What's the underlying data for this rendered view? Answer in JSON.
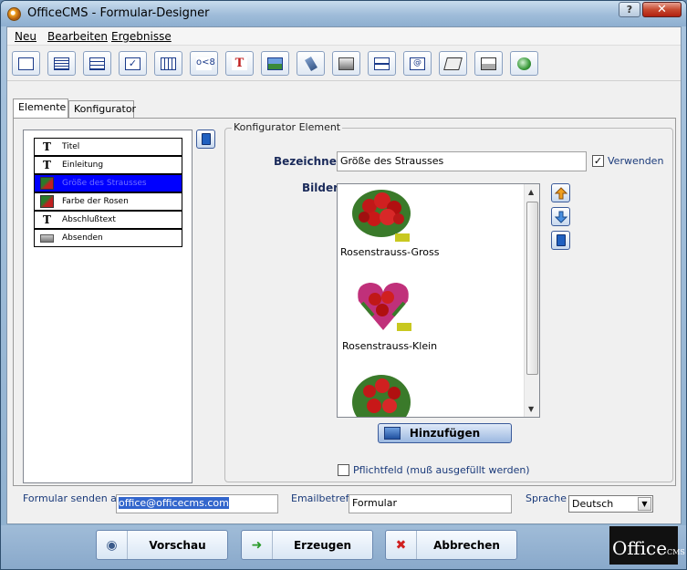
{
  "window": {
    "title": "OfficeCMS - Formular-Designer",
    "help": "?",
    "close": "✕"
  },
  "menu": [
    {
      "label": "Neu"
    },
    {
      "label": "Bearbeiten"
    },
    {
      "label": "Ergebnisse"
    }
  ],
  "toolbar": {
    "icons": [
      "single-field-icon",
      "text-block-icon",
      "list-icon",
      "checkbox-icon",
      "table-icon",
      "branch-icon",
      "title-text-icon",
      "image-icon",
      "attachment-icon",
      "button-icon",
      "separator-icon",
      "email-icon",
      "note-icon",
      "stamp-icon",
      "globe-icon"
    ]
  },
  "tabs": [
    {
      "label": "Elemente"
    },
    {
      "label": "Konfigurator"
    }
  ],
  "elements": {
    "items": [
      {
        "label": "Titel",
        "icon": "T"
      },
      {
        "label": "Einleitung",
        "icon": "T"
      },
      {
        "label": "Größe des Strausses",
        "icon": ""
      },
      {
        "label": "Farbe der Rosen",
        "icon": ""
      },
      {
        "label": "Abschlußtext",
        "icon": "T"
      },
      {
        "label": "Absenden",
        "icon": ""
      }
    ],
    "selected_index": 2
  },
  "config": {
    "group_title": "Konfigurator Element",
    "bezeichner_label": "Bezeichner",
    "bezeichner_value": "Größe des Strausses",
    "verwenden_label": "Verwenden",
    "verwenden_checked": true,
    "bilder_label": "Bilder",
    "images": [
      {
        "caption": "Rosenstrauss-Gross"
      },
      {
        "caption": "Rosenstrauss-Klein"
      }
    ],
    "add_button": "Hinzufügen",
    "pflichtfeld_label": "Pflichtfeld (muß ausgefüllt werden)",
    "pflichtfeld_checked": false
  },
  "bottom": {
    "send_label": "Formular senden an",
    "send_value": "office@officecms.com",
    "subject_label": "Emailbetreff",
    "subject_value": "Formular",
    "lang_label": "Sprache",
    "lang_value": "Deutsch"
  },
  "footer": {
    "preview": "Vorschau",
    "generate": "Erzeugen",
    "cancel": "Abbrechen",
    "logo": "Office",
    "logo_small": "CMS"
  }
}
